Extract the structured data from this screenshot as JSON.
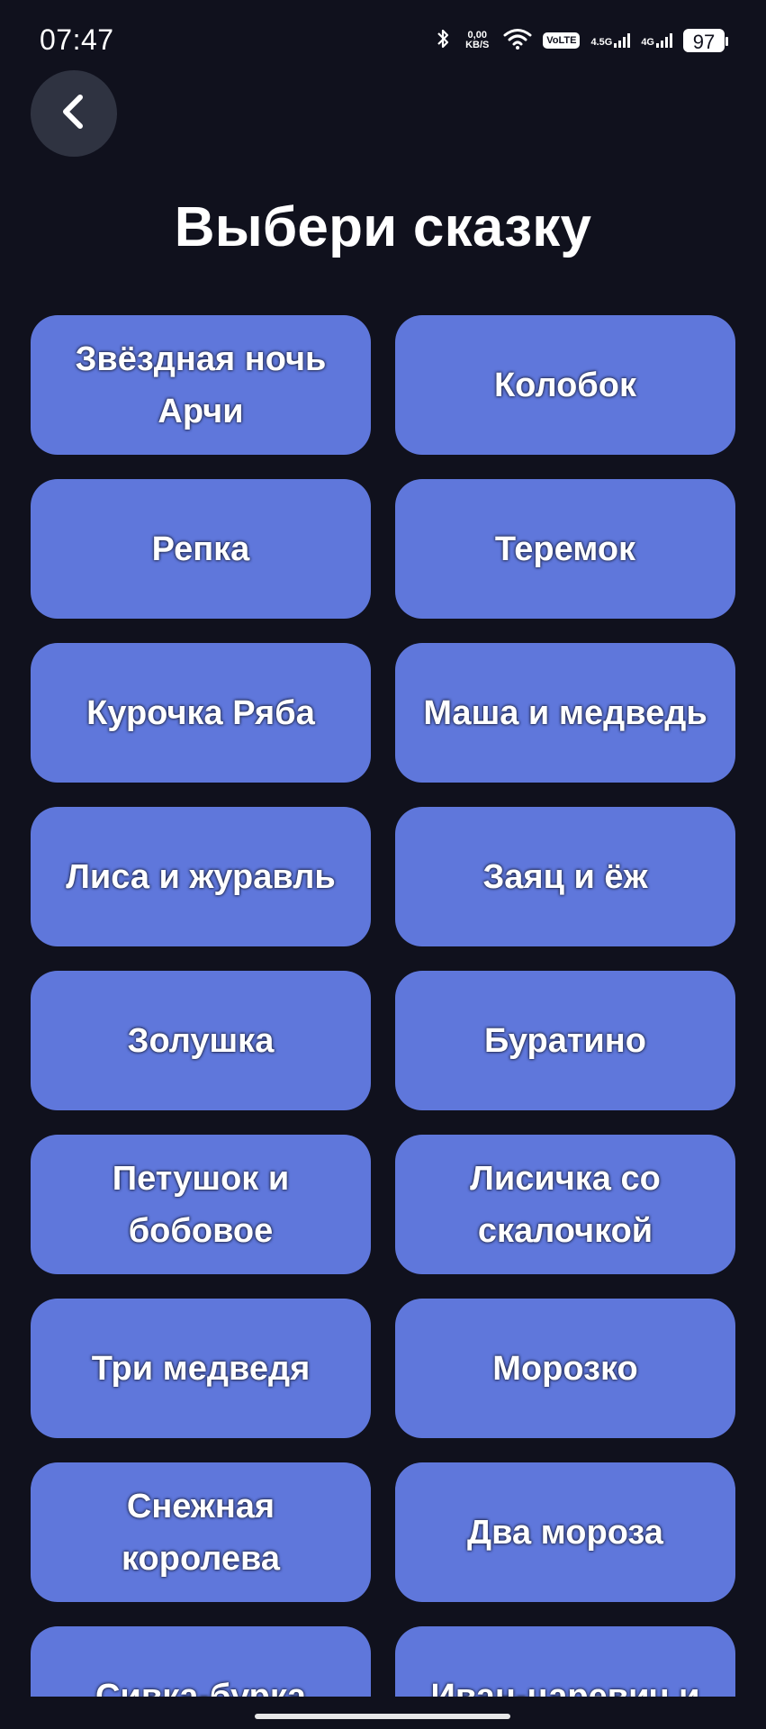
{
  "status_bar": {
    "time": "07:47",
    "network_speed": "0,00\nKB/S",
    "volte": "VoLTE",
    "sim1_label": "4.5G",
    "sim2_label": "4G",
    "battery": "97",
    "icons": [
      "bluetooth-icon",
      "wifi-icon",
      "signal-icon",
      "battery-icon"
    ]
  },
  "header": {
    "back_icon": "chevron-left-icon",
    "title": "Выбери сказку"
  },
  "tales": [
    "Звёздная ночь Арчи",
    "Колобок",
    "Репка",
    "Теремок",
    "Курочка Ряба",
    "Маша и медведь",
    "Лиса и журавль",
    "Заяц и ёж",
    "Золушка",
    "Буратино",
    "Петушок и бобовое",
    "Лисичка со скалочкой",
    "Три медведя",
    "Морозко",
    "Снежная королева",
    "Два мороза",
    "Сивка-бурка",
    "Иван-царевич и"
  ],
  "colors": {
    "background": "#10111d",
    "card": "#5f77db",
    "back_button": "#2f3341"
  }
}
